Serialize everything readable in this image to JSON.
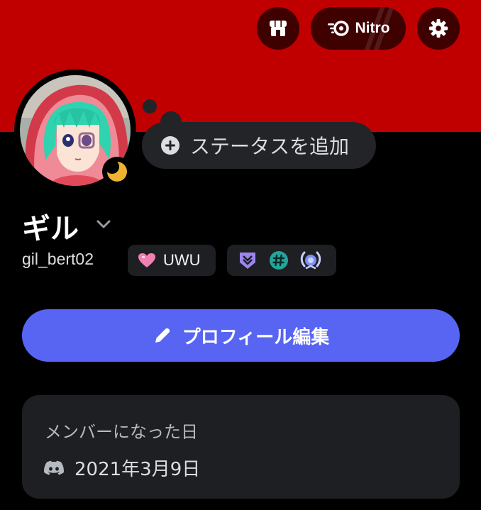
{
  "header": {
    "nitro_label": "Nitro",
    "colors": {
      "banner": "#c00000",
      "button_bg": "#3f0000"
    },
    "icons": {
      "shop": "shop-icon",
      "nitro": "nitro-icon",
      "settings": "gear-icon"
    }
  },
  "profile": {
    "display_name": "ギル",
    "username": "gil_bert02",
    "status_placeholder": "ステータスを追加",
    "presence": "idle",
    "tag": {
      "label": "UWU",
      "icon": "pink-heart-icon"
    },
    "badges": [
      "hypesquad-icon",
      "hashtag-badge-icon",
      "laurel-badge-icon"
    ]
  },
  "actions": {
    "edit_profile_label": "プロフィール編集",
    "accent": "#5865f2"
  },
  "member_since": {
    "title": "メンバーになった日",
    "date": "2021年3月9日",
    "icon": "discord-icon"
  }
}
